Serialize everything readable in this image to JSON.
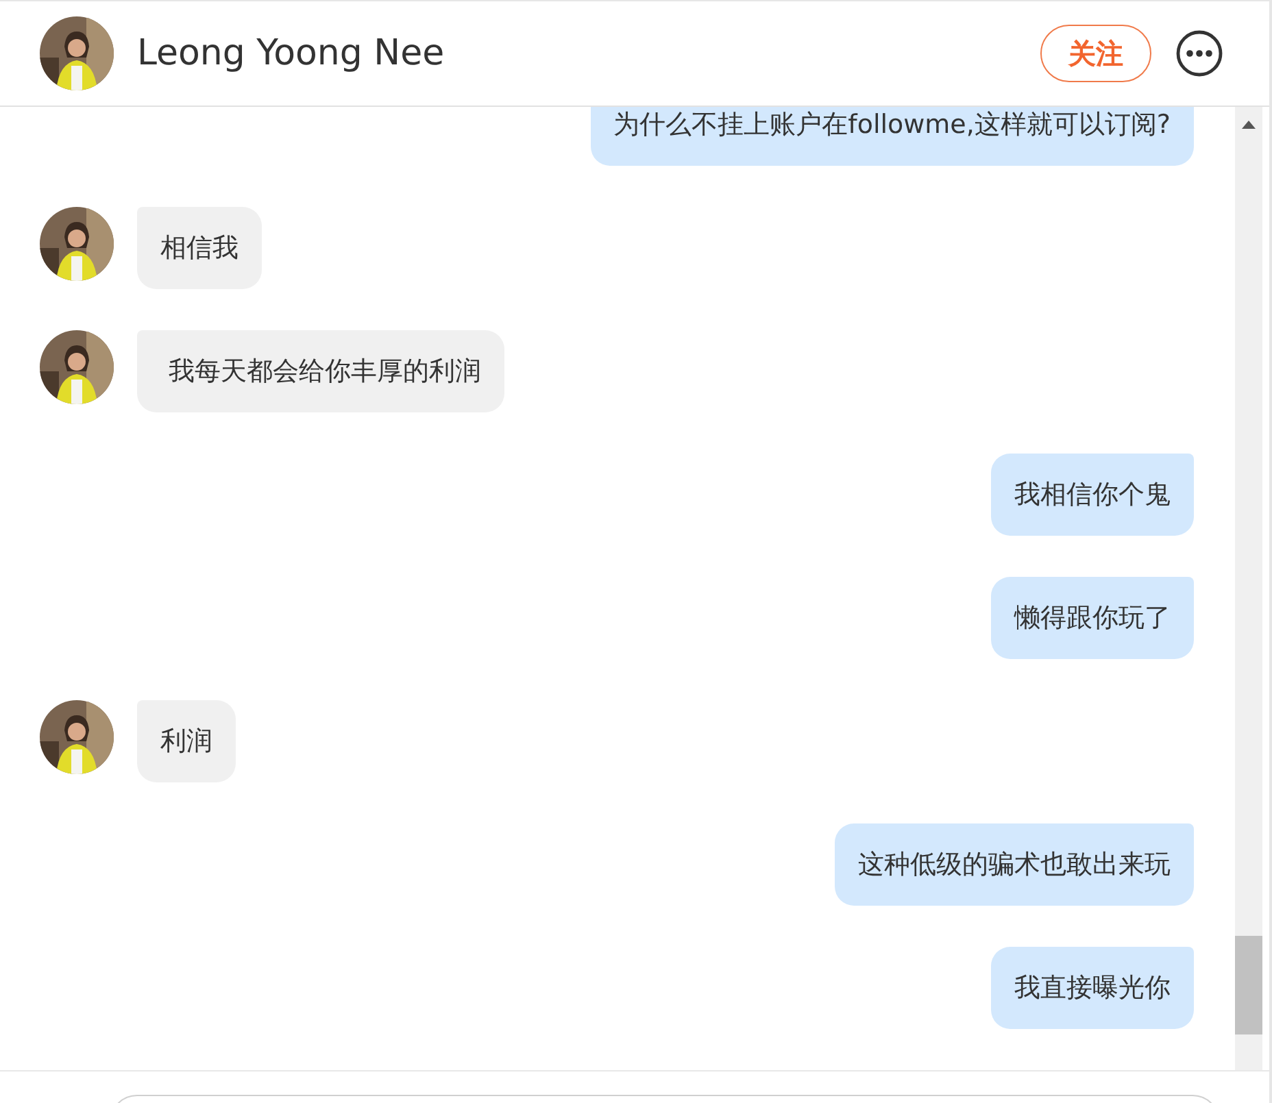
{
  "header": {
    "name": "Leong Yoong Nee",
    "follow_button": "关注"
  },
  "messages": [
    {
      "kind": "outgoing",
      "text": "为什么不挂上账户在followme,这样就可以订阅?"
    },
    {
      "kind": "incoming",
      "text": "相信我"
    },
    {
      "kind": "incoming",
      "text": " 我每天都会给你丰厚的利润"
    },
    {
      "kind": "outgoing",
      "text": "我相信你个鬼"
    },
    {
      "kind": "outgoing",
      "text": "懒得跟你玩了"
    },
    {
      "kind": "incoming",
      "text": "利润"
    },
    {
      "kind": "outgoing",
      "text": "这种低级的骗术也敢出来玩"
    },
    {
      "kind": "outgoing",
      "text": "我直接曝光你"
    }
  ]
}
